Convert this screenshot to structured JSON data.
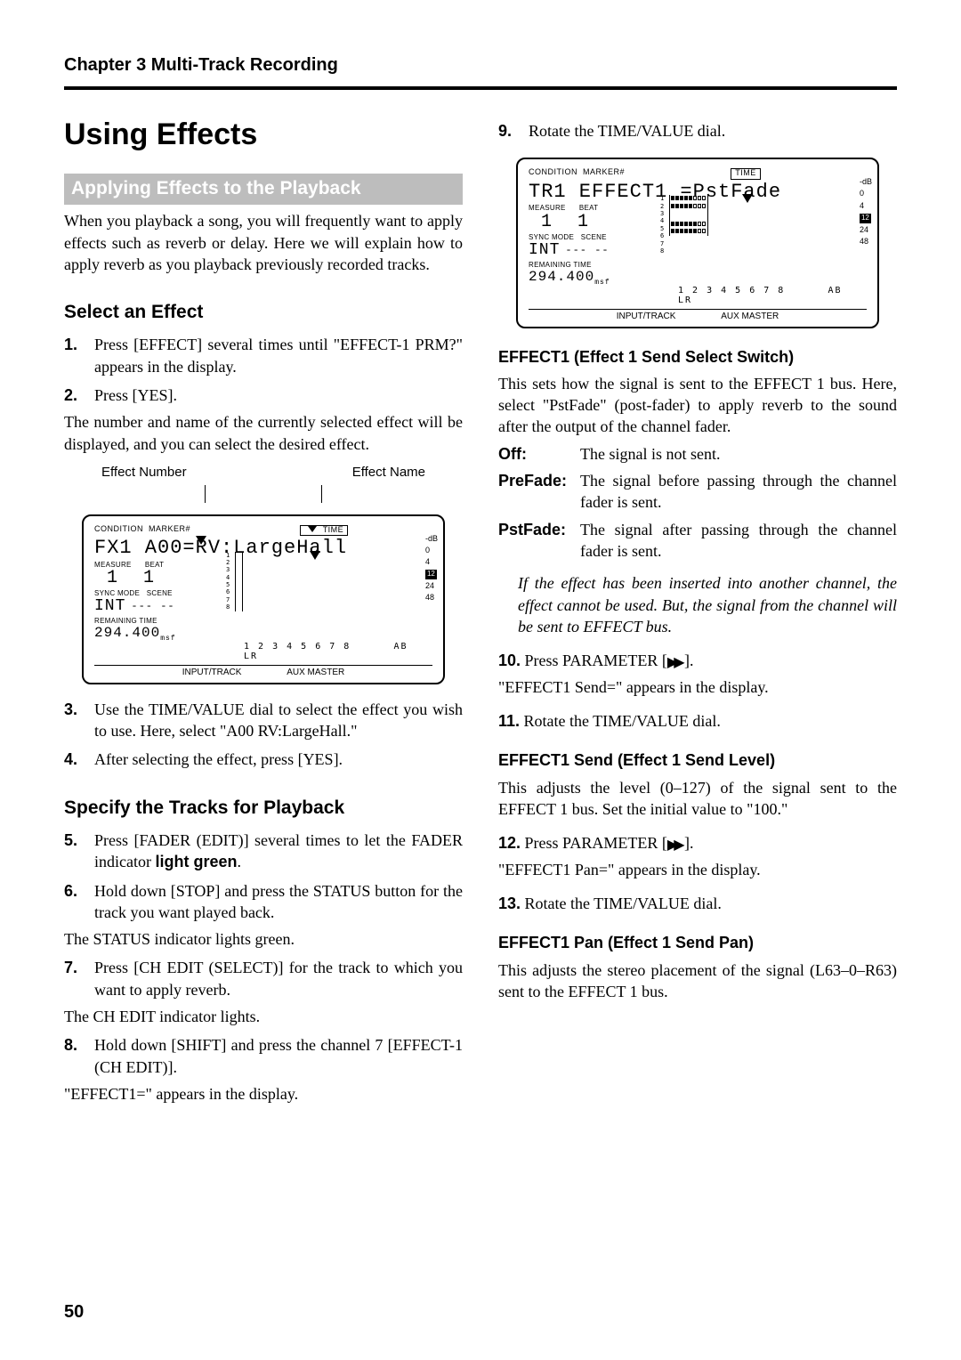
{
  "chapter": "Chapter 3 Multi-Track Recording",
  "title": "Using Effects",
  "banner": "Applying Effects to the Playback",
  "intro": "When you playback a song, you will frequently want to apply effects such as reverb or delay. Here we will explain how to apply reverb as you playback previously recorded tracks.",
  "sub_select": "Select an Effect",
  "steps": {
    "s1": "Press [EFFECT] several times until \"EFFECT-1 PRM?\" appears in the display.",
    "s2": "Press [YES].",
    "after2": "The number and name of the currently selected effect will be displayed, and you can select the desired effect.",
    "fig1_label_left": "Effect Number",
    "fig1_label_right": "Effect Name",
    "s3": "Use the TIME/VALUE dial to select the effect you wish to use. Here, select \"A00 RV:LargeHall.\"",
    "s4": "After selecting the effect, press [YES].",
    "sub_specify": "Specify the Tracks for Playback",
    "s5a": "Press [FADER (EDIT)] several times to let the FADER indicator ",
    "s5b": "light green",
    "s5c": ".",
    "s6": "Hold down [STOP] and press the STATUS button for the track you want played back.",
    "after6": "The STATUS indicator lights green.",
    "s7": "Press [CH EDIT (SELECT)] for the track to which you want to apply reverb.",
    "after7": "The CH EDIT indicator lights.",
    "s8": "Hold down [SHIFT] and press the channel 7 [EFFECT-1 (CH EDIT)].",
    "after8": "\"EFFECT1=\" appears in the display.",
    "s9": "Rotate the TIME/VALUE dial."
  },
  "fig_common": {
    "condition": "CONDITION",
    "marker": "MARKER#",
    "time": "TIME",
    "measure": "MEASURE",
    "beat": "BEAT",
    "sync": "SYNC MODE",
    "scene": "SCENE",
    "remain": "REMAINING TIME",
    "int": "INT",
    "dashes": "--- --",
    "remain_val": "294.400",
    "meter_nums": "1 2 3 4 5 6 7 8",
    "ab": "AB",
    "lr": "LR",
    "input_track": "INPUT/TRACK",
    "aux_master": "AUX MASTER",
    "db": "-dB",
    "db0": "0",
    "db4": "4",
    "db12": "12",
    "db24": "24",
    "db48": "48"
  },
  "fig1": {
    "line1": "FX1 A00=RV:LargeHall",
    "measure_val": "1",
    "beat_val": "1"
  },
  "fig2": {
    "line1": "TR1 EFFECT1  =PstFade",
    "measure_val": "1",
    "beat_val": "1"
  },
  "right": {
    "head1": "EFFECT1 (Effect 1 Send Select Switch)",
    "p1": "This sets how the signal is sent to the EFFECT 1 bus. Here, select \"PstFade\" (post-fader) to apply reverb to the sound after the output of the channel fader.",
    "off_t": "Off:",
    "off_d": "The signal is not sent.",
    "pre_t": "PreFade:",
    "pre_d": "The signal before passing through the channel fader is sent.",
    "pst_t": "PstFade:",
    "pst_d": "The signal after passing through the channel fader is sent.",
    "note": "If the effect has been inserted into another channel, the effect cannot be used. But, the signal from the channel will be sent to EFFECT bus.",
    "s10a": "Press PARAMETER [",
    "s10b": "].",
    "after10": "\"EFFECT1 Send=\" appears in the display.",
    "s11": "Rotate the TIME/VALUE dial.",
    "head2": "EFFECT1 Send (Effect 1 Send Level)",
    "p2": "This adjusts the level (0–127) of the signal sent to the EFFECT 1 bus. Set the initial value to \"100.\"",
    "s12a": "Press PARAMETER [",
    "s12b": "].",
    "after12": "\"EFFECT1 Pan=\" appears in the display.",
    "s13": "Rotate the TIME/VALUE dial.",
    "head3": "EFFECT1 Pan (Effect 1 Send Pan)",
    "p3": "This adjusts the stereo placement of the signal (L63–0–R63) sent to the EFFECT 1 bus."
  },
  "pagenum": "50",
  "n1": "1.",
  "n2": "2.",
  "n3": "3.",
  "n4": "4.",
  "n5": "5.",
  "n6": "6.",
  "n7": "7.",
  "n8": "8.",
  "n9": "9.",
  "n10": "10.",
  "n11": "11.",
  "n12": "12.",
  "n13": "13."
}
